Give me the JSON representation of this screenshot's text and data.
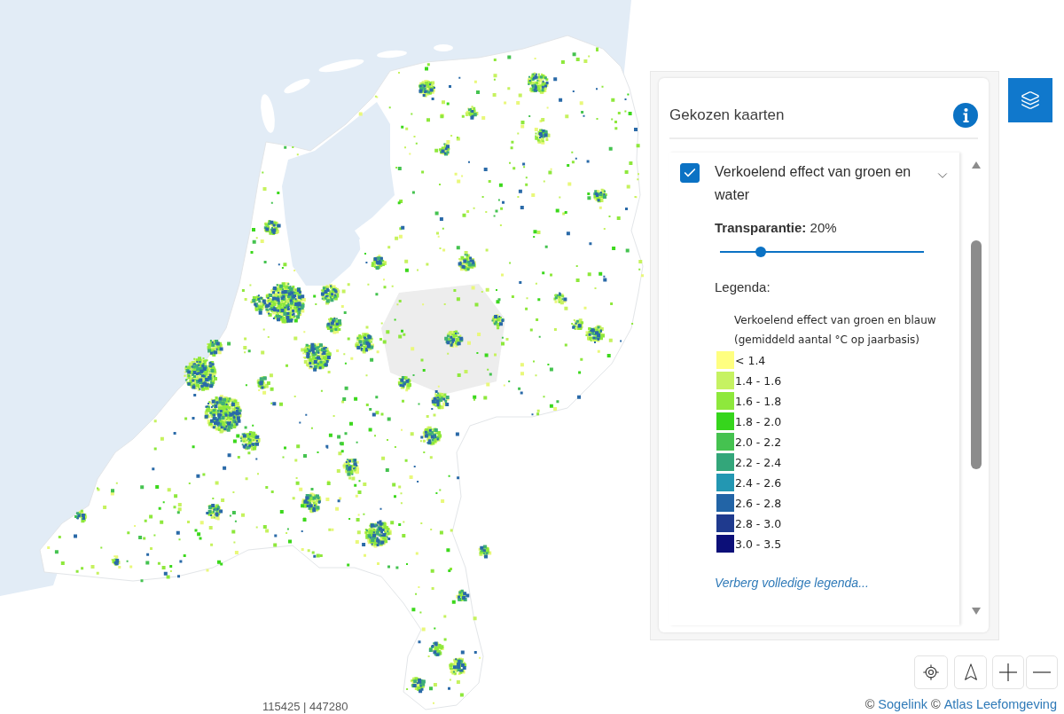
{
  "panel": {
    "title": "Gekozen kaarten",
    "layers": [
      {
        "title": "Verkoelend effect van groen en water",
        "checked": true,
        "expanded": true,
        "transparency": {
          "label": "**Transparantie:** 20%",
          "level": 0.2
        },
        "legend": {
          "heading": "Legenda:",
          "title": "Verkoelend effect van groen en blauw (gemiddeld aantal °C op jaarbasis)",
          "items": [
            {
              "label": "< 1.4",
              "color": "#ffff80"
            },
            {
              "label": "1.4 - 1.6",
              "color": "#c6f262"
            },
            {
              "label": "1.6 - 1.8",
              "color": "#8ee83c"
            },
            {
              "label": "1.8 - 2.0",
              "color": "#36d51c"
            },
            {
              "label": "2.0 - 2.2",
              "color": "#45c250"
            },
            {
              "label": "2.2 - 2.4",
              "color": "#33a67a"
            },
            {
              "label": "2.4 - 2.6",
              "color": "#2397b2"
            },
            {
              "label": "2.6 - 2.8",
              "color": "#2264a6"
            },
            {
              "label": "2.8 - 3.0",
              "color": "#1f3a8e"
            },
            {
              "label": "3.0 - 3.5",
              "color": "#0c0f78"
            }
          ]
        },
        "legend_toggle": "Verberg volledige legenda..."
      }
    ]
  },
  "coordinates": "115425 | 447280",
  "attribution": [
    {
      "prefix": "©",
      "link": "Sogelink"
    },
    {
      "prefix": "©",
      "link": "Atlas Leefomgeving"
    }
  ]
}
